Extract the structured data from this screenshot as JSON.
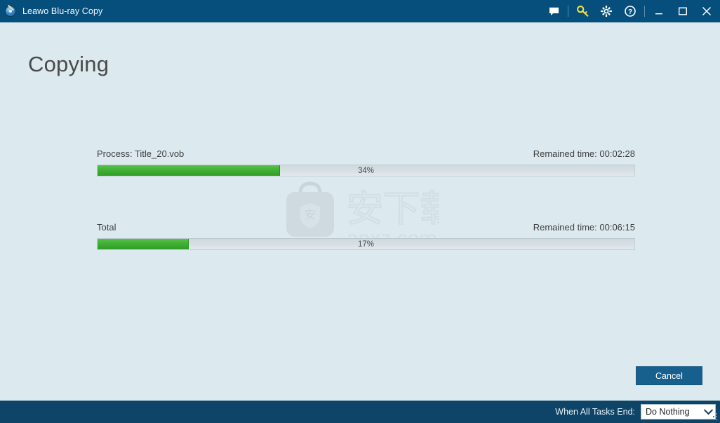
{
  "window": {
    "title": "Leawo Blu-ray Copy",
    "app_icon": "bluray-disc-icon",
    "titlebar_color": "#064f7c",
    "background_color": "#dceaef"
  },
  "titlebar_buttons": [
    {
      "name": "feedback-icon",
      "label": "Feedback"
    },
    {
      "name": "key-icon",
      "label": "Register",
      "color": "#f2e33a"
    },
    {
      "name": "gear-icon",
      "label": "Settings"
    },
    {
      "name": "help-icon",
      "label": "Help"
    }
  ],
  "window_controls": [
    {
      "name": "minimize-button",
      "label": "Minimize"
    },
    {
      "name": "maximize-button",
      "label": "Maximize"
    },
    {
      "name": "close-button",
      "label": "Close"
    }
  ],
  "main": {
    "page_title": "Copying",
    "progress_items": [
      {
        "label": "Process:  Title_20.vob",
        "remaining_label": "Remained time:  00:02:28",
        "percent_text": "34%",
        "percent": 34
      },
      {
        "label": "Total",
        "remaining_label": "Remained time:  00:06:15",
        "percent_text": "17%",
        "percent": 17
      }
    ],
    "cancel_label": "Cancel"
  },
  "watermark": {
    "site": "anxz.com",
    "characters": "安下载",
    "badge_character": "安"
  },
  "statusbar": {
    "when_all_tasks_end_label": "When All Tasks End:",
    "selected_option": "Do Nothing",
    "options": [
      "Do Nothing"
    ],
    "background_color": "#0d4468"
  },
  "colors": {
    "progress_green": "#3fae32",
    "accent_blue": "#175f8d"
  }
}
